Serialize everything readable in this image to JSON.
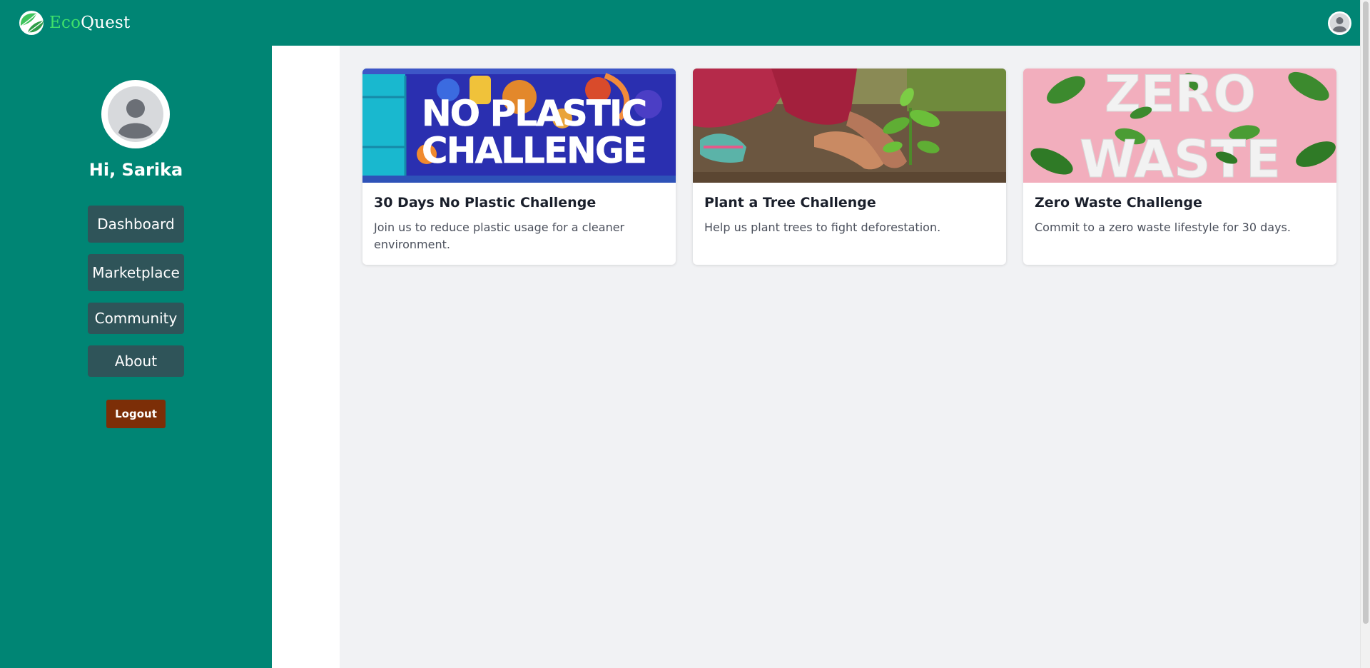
{
  "app": {
    "logo_part1": "Eco",
    "logo_part2": "Quest",
    "brand_color": "#008574",
    "accent_color": "#3ee16b",
    "logo_icon": "leaf-logo-icon",
    "profile_icon": "user-avatar-icon"
  },
  "sidebar": {
    "greeting": "Hi, Sarika",
    "nav": [
      {
        "label": "Dashboard"
      },
      {
        "label": "Marketplace"
      },
      {
        "label": "Community"
      },
      {
        "label": "About"
      }
    ],
    "logout_label": "Logout",
    "nav_button_color": "#2f5459",
    "logout_color": "#7c2e07"
  },
  "challenges": [
    {
      "title": "30 Days No Plastic Challenge",
      "description": "Join us to reduce plastic usage for a cleaner environment.",
      "image_text_line1": "NO PLASTIC",
      "image_text_line2": "CHALLENGE"
    },
    {
      "title": "Plant a Tree Challenge",
      "description": "Help us plant trees to fight deforestation."
    },
    {
      "title": "Zero Waste Challenge",
      "description": "Commit to a zero waste lifestyle for 30 days.",
      "image_text_line1": "ZERO",
      "image_text_line2": "WASTE"
    }
  ]
}
